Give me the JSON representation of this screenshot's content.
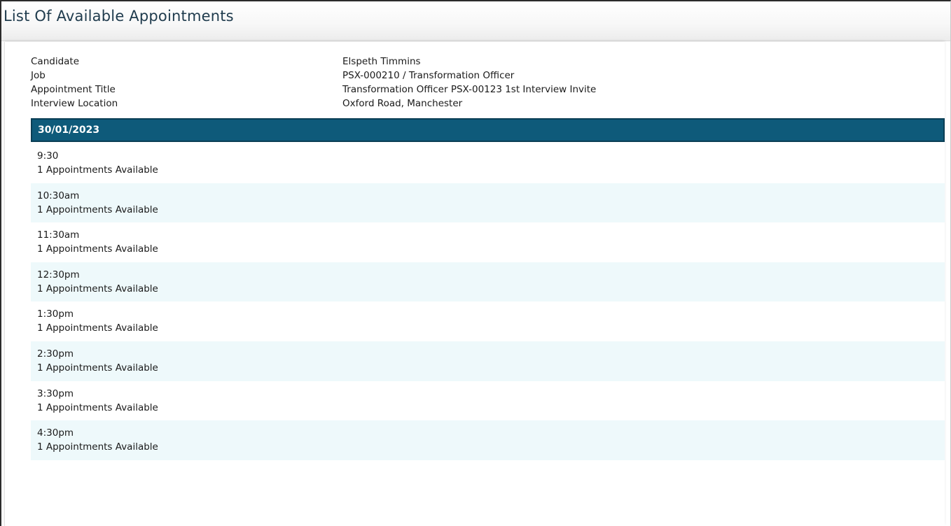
{
  "page": {
    "title": "List Of Available Appointments"
  },
  "details": [
    {
      "label": "Candidate",
      "value": "Elspeth Timmins"
    },
    {
      "label": "Job",
      "value": "PSX-000210 / Transformation Officer"
    },
    {
      "label": "Appointment Title",
      "value": "Transformation Officer PSX-00123 1st Interview Invite"
    },
    {
      "label": "Interview Location",
      "value": "Oxford Road, Manchester"
    }
  ],
  "date": "30/01/2023",
  "slots": [
    {
      "time": "9:30",
      "availability": "1 Appointments Available"
    },
    {
      "time": "10:30am",
      "availability": "1 Appointments Available"
    },
    {
      "time": "11:30am",
      "availability": "1 Appointments Available"
    },
    {
      "time": "12:30pm",
      "availability": "1 Appointments Available"
    },
    {
      "time": "1:30pm",
      "availability": "1 Appointments Available"
    },
    {
      "time": "2:30pm",
      "availability": "1 Appointments Available"
    },
    {
      "time": "3:30pm",
      "availability": "1 Appointments Available"
    },
    {
      "time": "4:30pm",
      "availability": "1 Appointments Available"
    }
  ],
  "colors": {
    "date_bar": "#0e5a7a",
    "alt_row": "#eef9fb",
    "title_text": "#1f3b4d"
  }
}
